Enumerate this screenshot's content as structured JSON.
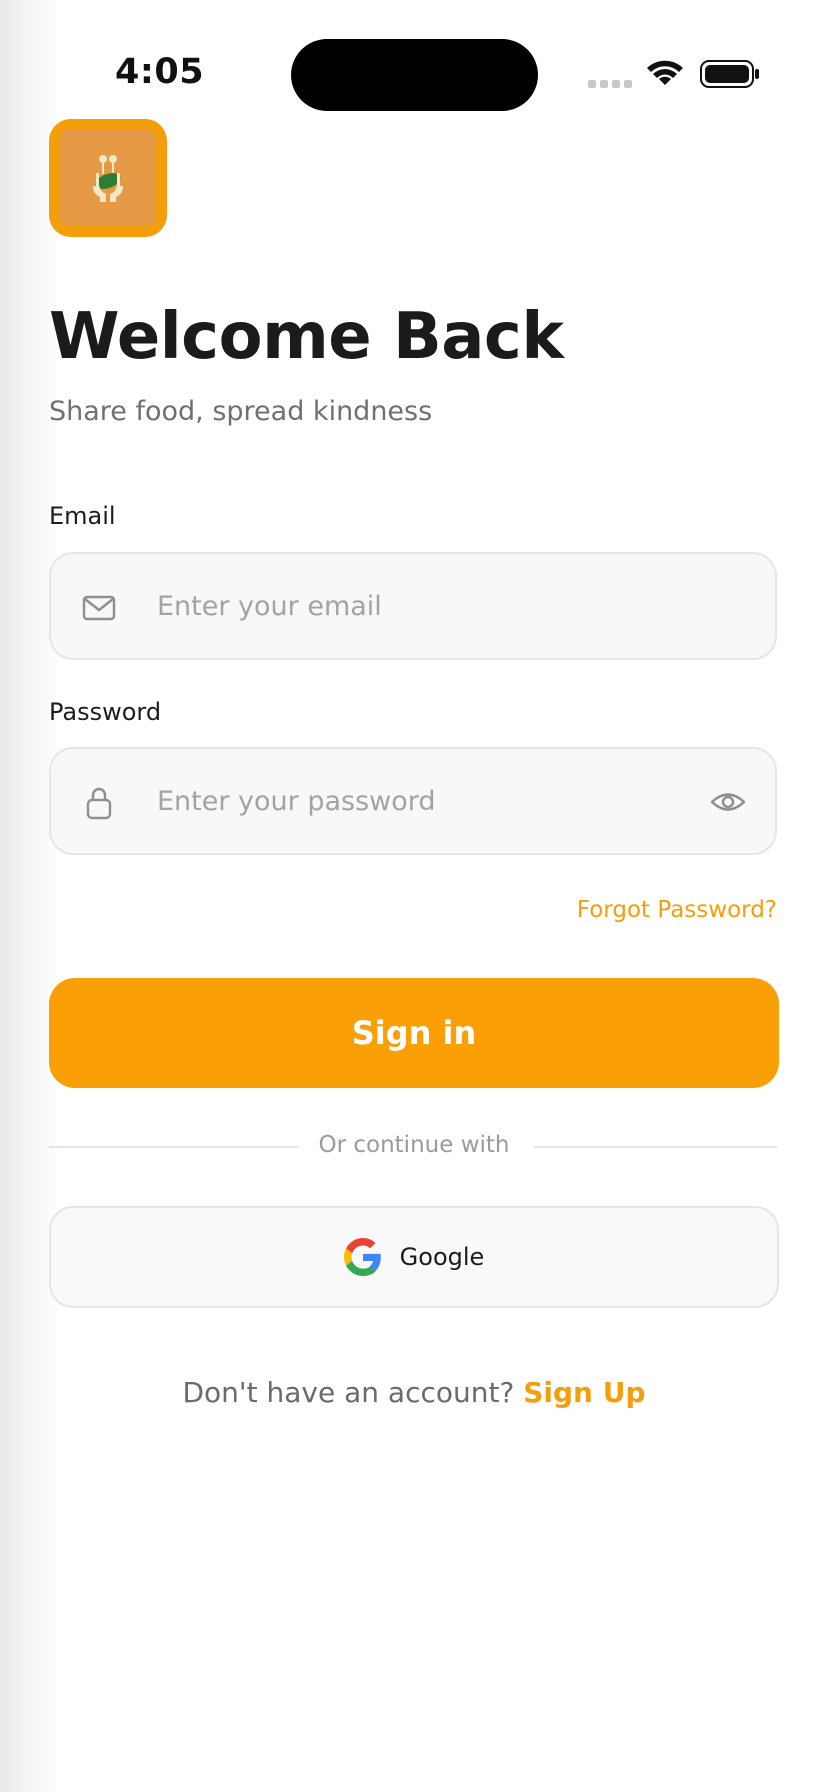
{
  "status_bar": {
    "time": "4:05"
  },
  "logo": {
    "name": "food-sharing-hands-logo"
  },
  "header": {
    "title": "Welcome Back",
    "subtitle": "Share food, spread kindness"
  },
  "form": {
    "email": {
      "label": "Email",
      "placeholder": "Enter your email",
      "value": ""
    },
    "password": {
      "label": "Password",
      "placeholder": "Enter your password",
      "value": ""
    },
    "forgot_password": "Forgot Password?",
    "sign_in": "Sign in"
  },
  "divider": {
    "text": "Or continue with"
  },
  "social": {
    "google": "Google"
  },
  "footer": {
    "prompt": "Don't have an account?",
    "link": "Sign Up"
  },
  "colors": {
    "accent": "#f59e0b",
    "button": "#fb9f06",
    "field_bg": "#f8f8f8"
  }
}
